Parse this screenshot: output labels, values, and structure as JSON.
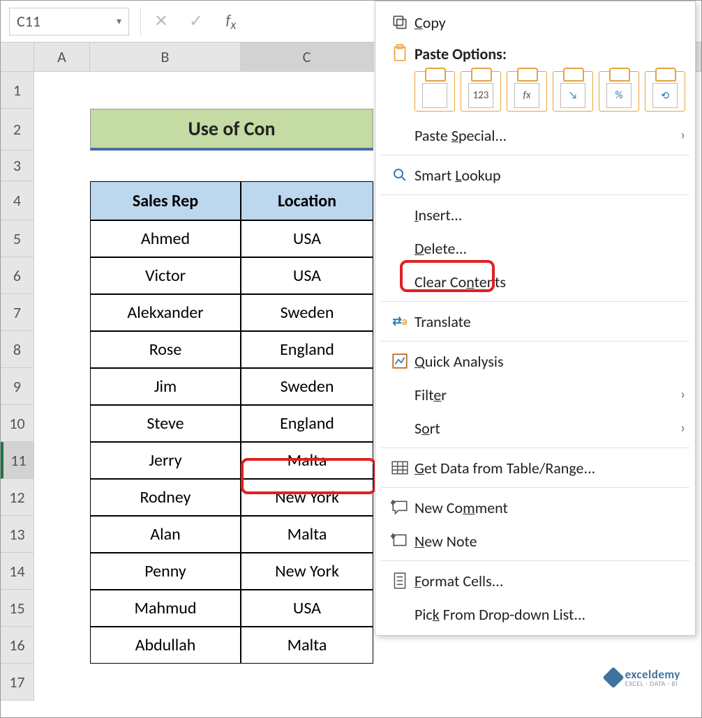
{
  "name_box": "C11",
  "columns": [
    "A",
    "B",
    "C"
  ],
  "row_numbers": [
    1,
    2,
    3,
    4,
    5,
    6,
    7,
    8,
    9,
    10,
    11,
    12,
    13,
    14,
    15,
    16,
    17
  ],
  "title": "Use of Con",
  "headers": {
    "b": "Sales Rep",
    "c": "Location"
  },
  "data": [
    {
      "rep": "Ahmed",
      "loc": "USA"
    },
    {
      "rep": "Victor",
      "loc": "USA"
    },
    {
      "rep": "Alekxander",
      "loc": "Sweden"
    },
    {
      "rep": "Rose",
      "loc": "England"
    },
    {
      "rep": "Jim",
      "loc": "Sweden"
    },
    {
      "rep": "Steve",
      "loc": "England"
    },
    {
      "rep": "Jerry",
      "loc": "Malta"
    },
    {
      "rep": "Rodney",
      "loc": "New York"
    },
    {
      "rep": "Alan",
      "loc": "Malta"
    },
    {
      "rep": "Penny",
      "loc": "New York"
    },
    {
      "rep": "Mahmud",
      "loc": "USA"
    },
    {
      "rep": "Abdullah",
      "loc": "Malta"
    }
  ],
  "selected_row": 11,
  "context_menu": {
    "copy": "Copy",
    "paste_options_title": "Paste Options:",
    "paste_icons": [
      "",
      "123",
      "fx",
      "↘",
      "%",
      "⟲"
    ],
    "paste_special": "Paste Special...",
    "smart_lookup": "Smart Lookup",
    "insert": "Insert...",
    "delete": "Delete...",
    "clear": "Clear Contents",
    "translate": "Translate",
    "quick_analysis": "Quick Analysis",
    "filter": "Filter",
    "sort": "Sort",
    "get_data": "Get Data from Table/Range...",
    "new_comment": "New Comment",
    "new_note": "New Note",
    "format_cells": "Format Cells...",
    "pick": "Pick From Drop-down List..."
  },
  "watermark": {
    "brand": "exceldemy",
    "sub": "EXCEL · DATA · BI"
  }
}
